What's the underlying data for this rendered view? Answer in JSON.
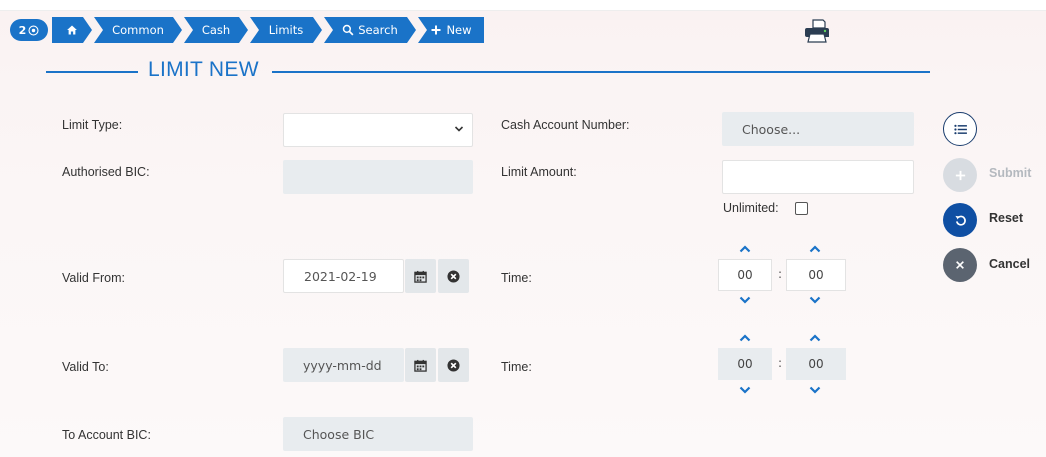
{
  "breadcrumb": {
    "count": "2",
    "items": [
      "Common",
      "Cash",
      "Limits",
      "Search",
      "New"
    ]
  },
  "page": {
    "title": "LIMIT NEW"
  },
  "form": {
    "limit_type": {
      "label": "Limit Type:",
      "value": ""
    },
    "cash_account_number": {
      "label": "Cash Account Number:",
      "placeholder": "Choose..."
    },
    "authorised_bic": {
      "label": "Authorised BIC:",
      "value": ""
    },
    "limit_amount": {
      "label": "Limit Amount:",
      "value": ""
    },
    "unlimited": {
      "label": "Unlimited:",
      "checked": false
    },
    "valid_from": {
      "label": "Valid From:",
      "value": "2021-02-19"
    },
    "valid_from_time": {
      "label": "Time:",
      "hours": "00",
      "minutes": "00",
      "separator": ":"
    },
    "valid_to": {
      "label": "Valid To:",
      "placeholder": "yyyy-mm-dd"
    },
    "valid_to_time": {
      "label": "Time:",
      "hours": "00",
      "minutes": "00",
      "separator": ":"
    },
    "to_account_bic": {
      "label": "To Account BIC:",
      "placeholder": "Choose BIC"
    }
  },
  "actions": {
    "submit": "Submit",
    "reset": "Reset",
    "cancel": "Cancel"
  },
  "colors": {
    "accent": "#1a73c8",
    "mandatory": "#b0373c",
    "valid": "#4caf50",
    "cancel_button": "#5b6470",
    "disabled": "#c4c9cf"
  },
  "icons": [
    "eye-icon",
    "home-icon",
    "search-icon",
    "plus-icon",
    "printer-icon",
    "chevron-down-icon",
    "calendar-icon",
    "clear-icon",
    "chevron-up-icon",
    "list-icon",
    "undo-icon",
    "close-icon"
  ]
}
